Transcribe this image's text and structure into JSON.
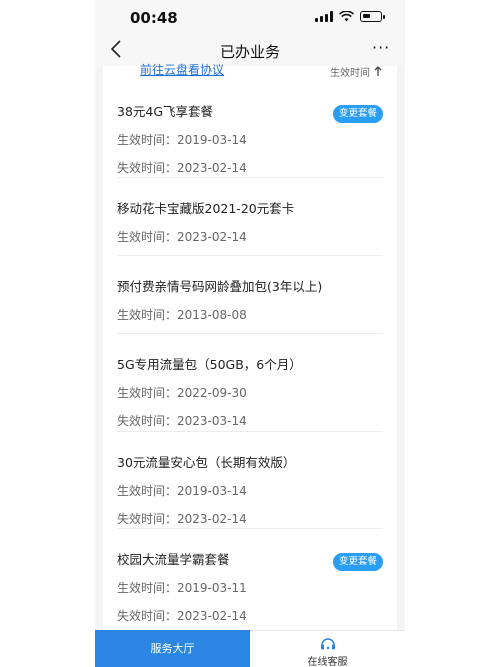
{
  "status_bar": {
    "time": "00:48"
  },
  "nav": {
    "title": "已办业务",
    "back_icon": "chevron-left-icon",
    "more_icon": "more-icon",
    "more_label": "···"
  },
  "top": {
    "link_text": "前往云盘看协议",
    "sort_label": "生效时间",
    "sort_icon": "arrow-up-icon"
  },
  "labels": {
    "effective": "生效时间：",
    "expire": "失效时间："
  },
  "items": [
    {
      "name": "38元4G飞享套餐",
      "effective": "2019-03-14",
      "expire": "2023-02-14",
      "action": "变更套餐"
    },
    {
      "name": "移动花卡宝藏版2021-20元套卡",
      "effective": "2023-02-14"
    },
    {
      "name": "预付费亲情号码网龄叠加包(3年以上)",
      "effective": "2013-08-08"
    },
    {
      "name": "5G专用流量包（50GB，6个月）",
      "effective": "2022-09-30",
      "expire": "2023-03-14"
    },
    {
      "name": "30元流量安心包（长期有效版）",
      "effective": "2019-03-14",
      "expire": "2023-02-14"
    },
    {
      "name": "校园大流量学霸套餐",
      "effective": "2019-03-11",
      "expire": "2023-02-14",
      "action": "变更套餐"
    }
  ],
  "bottom_tabs": {
    "hall": "服务大厅",
    "service": "在线客服",
    "service_icon": "headset-icon"
  },
  "colors": {
    "accent": "#2a9df4",
    "tab_active": "#2a86e2",
    "link": "#1e6fd9"
  }
}
